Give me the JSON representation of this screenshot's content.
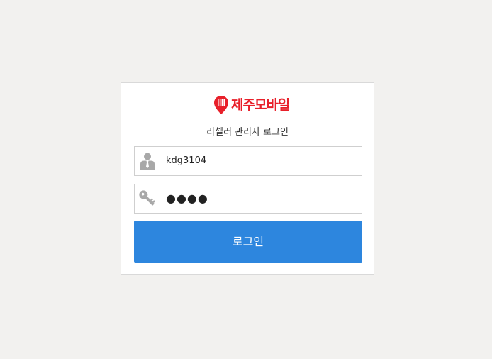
{
  "brand": {
    "logo_text": "제주모바일",
    "accent_color": "#e8202a"
  },
  "login": {
    "subtitle": "리셀러 관리자 로그인",
    "username": {
      "value": "kdg3104",
      "icon": "user-icon"
    },
    "password": {
      "masked_value": "●●●●",
      "icon": "key-icon"
    },
    "submit_label": "로그인",
    "button_color": "#2d86de"
  }
}
